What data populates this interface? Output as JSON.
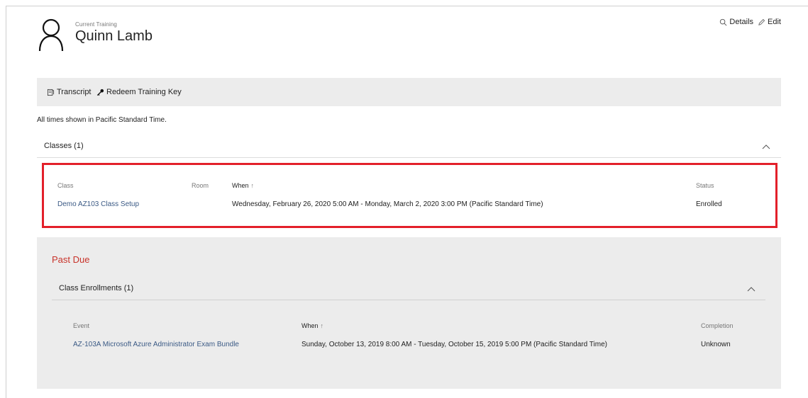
{
  "header": {
    "subtitle": "Current Training",
    "name": "Quinn Lamb",
    "details_label": "Details",
    "edit_label": "Edit"
  },
  "toolbar": {
    "transcript_label": "Transcript",
    "redeem_label": "Redeem Training Key"
  },
  "timezone_note": "All times shown in Pacific Standard Time.",
  "classes_section": {
    "title": "Classes (1)",
    "columns": {
      "class": "Class",
      "room": "Room",
      "when": "When",
      "status": "Status"
    },
    "rows": [
      {
        "class": "Demo AZ103 Class Setup",
        "room": "",
        "when": "Wednesday, February 26, 2020 5:00 AM - Monday, March 2, 2020 3:00 PM (Pacific Standard Time)",
        "status": "Enrolled"
      }
    ]
  },
  "past_due": {
    "title": "Past Due",
    "enrollments_title": "Class Enrollments (1)",
    "columns": {
      "event": "Event",
      "when": "When",
      "completion": "Completion"
    },
    "rows": [
      {
        "event": "AZ-103A Microsoft Azure Administrator Exam Bundle",
        "when": "Sunday, October 13, 2019 8:00 AM - Tuesday, October 15, 2019 5:00 PM (Pacific Standard Time)",
        "completion": "Unknown"
      }
    ]
  },
  "sort_indicator": "↑",
  "colors": {
    "highlight_border": "#e3202a",
    "past_due_title": "#c8332a",
    "link": "#3b5a85",
    "panel_bg": "#ececec"
  }
}
